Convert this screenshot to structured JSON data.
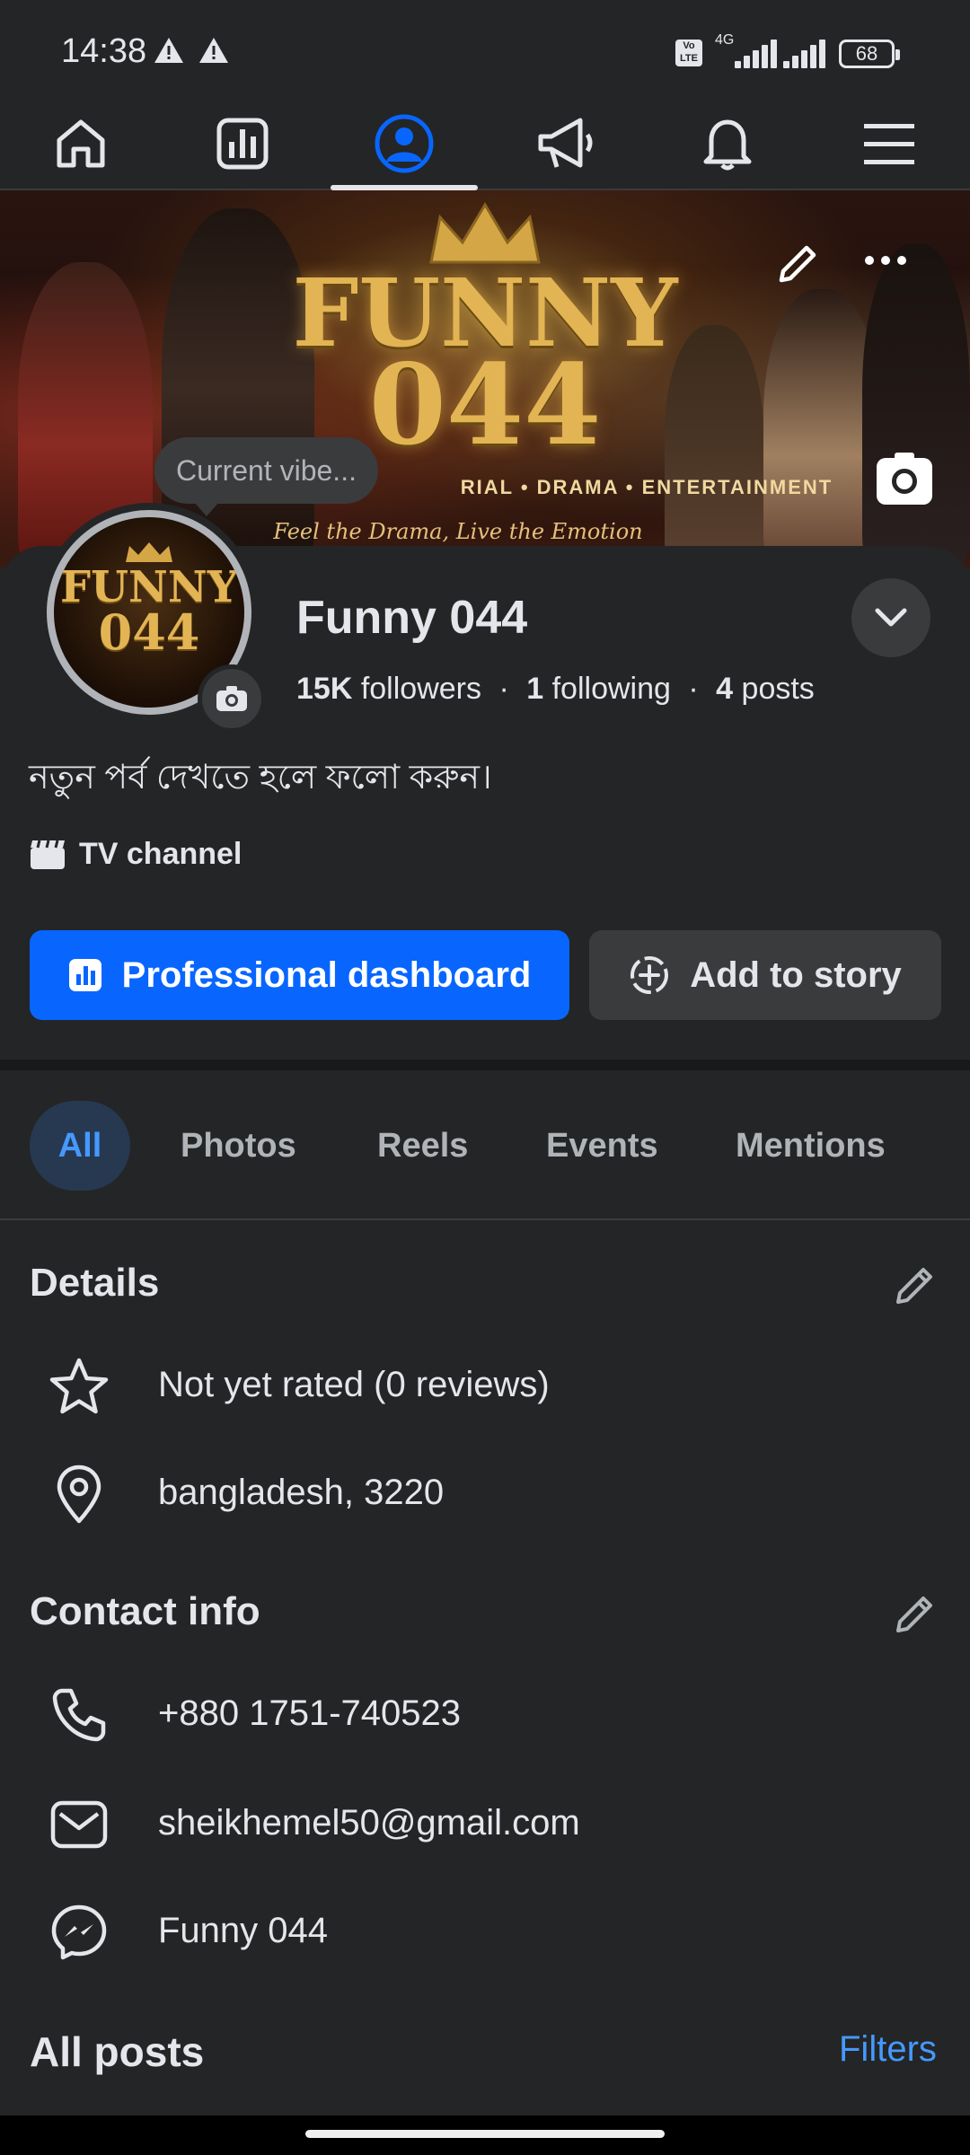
{
  "status_bar": {
    "time": "14:38",
    "volte": "Vo LTE",
    "network": "4G",
    "battery": "68"
  },
  "nav": {
    "items": [
      {
        "name": "home",
        "icon": "home-icon"
      },
      {
        "name": "dashboard",
        "icon": "bar-chart-icon"
      },
      {
        "name": "profile",
        "icon": "profile-icon",
        "active": true
      },
      {
        "name": "ads",
        "icon": "megaphone-icon"
      },
      {
        "name": "notifications",
        "icon": "bell-icon"
      },
      {
        "name": "menu",
        "icon": "hamburger-menu-icon"
      }
    ]
  },
  "cover": {
    "title_line1": "FUNNY",
    "title_line2": "044",
    "subtitle": "RIAL  •  DRAMA  •  ENTERTAINMENT",
    "tagline": "Feel the Drama, Live the Emotion"
  },
  "vibe": {
    "placeholder": "Current vibe..."
  },
  "avatar": {
    "line1": "FUNNY",
    "line2": "044"
  },
  "profile": {
    "name": "Funny 044",
    "followers_count": "15K",
    "followers_label": "followers",
    "following_count": "1",
    "following_label": "following",
    "posts_count": "4",
    "posts_label": "posts",
    "separator": "·",
    "bio": "নতুন পর্ব দেখতে হলে ফলো করুন।",
    "category": "TV channel"
  },
  "actions": {
    "primary": "Professional dashboard",
    "secondary": "Add to story"
  },
  "tabs": [
    "All",
    "Photos",
    "Reels",
    "Events",
    "Mentions"
  ],
  "details": {
    "heading": "Details",
    "rating": "Not yet rated (0 reviews)",
    "location": "bangladesh, 3220"
  },
  "contact": {
    "heading": "Contact info",
    "phone": "+880 1751-740523",
    "email": "sheikhemel50@gmail.com",
    "messenger": "Funny 044"
  },
  "posts": {
    "heading": "All posts",
    "filters": "Filters"
  },
  "colors": {
    "background": "#242526",
    "accent": "#0866ff",
    "link": "#4599ff",
    "gold": "#e2b454"
  }
}
